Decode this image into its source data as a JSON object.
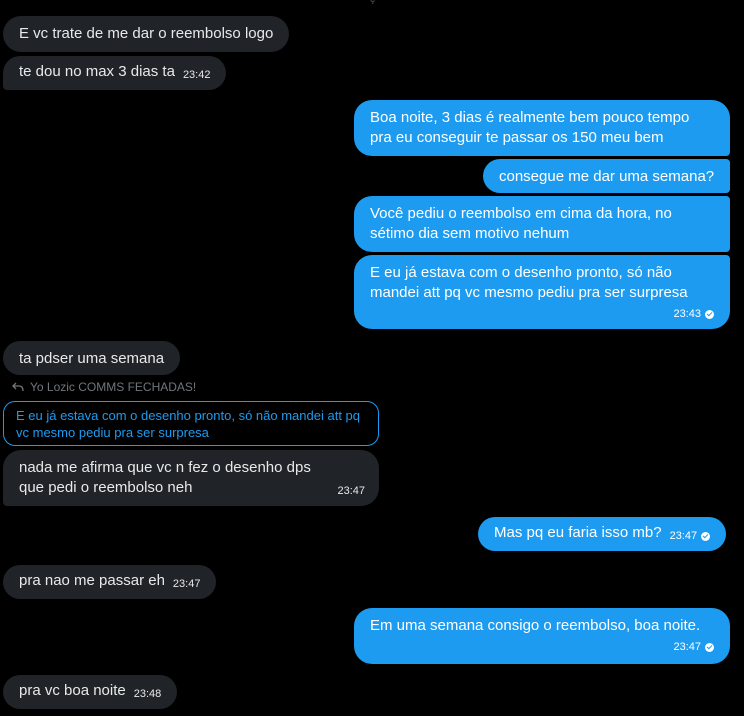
{
  "top_mark": "ç",
  "messages": [
    {
      "text": "E vc trate de me dar o reembolso logo",
      "time": ""
    },
    {
      "text": "te dou no max 3 dias ta",
      "time": "23:42"
    },
    {
      "text": "Boa noite, 3 dias é realmente bem pouco tempo pra eu conseguir te passar os 150 meu bem",
      "time": ""
    },
    {
      "text": "consegue me dar uma semana?",
      "time": ""
    },
    {
      "text": "Você pediu o reembolso em cima da hora, no sétimo dia sem motivo nehum",
      "time": ""
    },
    {
      "text": "E eu já estava com o desenho pronto, só não mandei att pq vc mesmo pediu pra ser surpresa",
      "time": "23:43"
    },
    {
      "text": "ta pdser uma semana",
      "time": ""
    },
    {
      "text": "nada me afirma que vc n fez o desenho dps que pedi o reembolso neh",
      "time": "23:47"
    },
    {
      "text": "Mas pq eu faria isso mb?",
      "time": "23:47"
    },
    {
      "text": "pra nao me passar eh",
      "time": "23:47"
    },
    {
      "text": "Em uma semana consigo o reembolso, boa noite.",
      "time": "23:47"
    },
    {
      "text": "pra vc boa noite",
      "time": "23:48"
    }
  ],
  "reply": {
    "header": "Yo Lozic COMMS FECHADAS!",
    "quoted": "E eu já estava com o desenho pronto, só não mandei att pq vc mesmo pediu pra ser surpresa"
  },
  "colors": {
    "background": "#000000",
    "incoming_bubble": "#202327",
    "outgoing_bubble": "#1d9bf0",
    "reply_accent": "#1d9bf0",
    "muted_text": "#71767b"
  },
  "icons": {
    "reply": "reply-arrow-icon",
    "read": "read-check-icon"
  }
}
